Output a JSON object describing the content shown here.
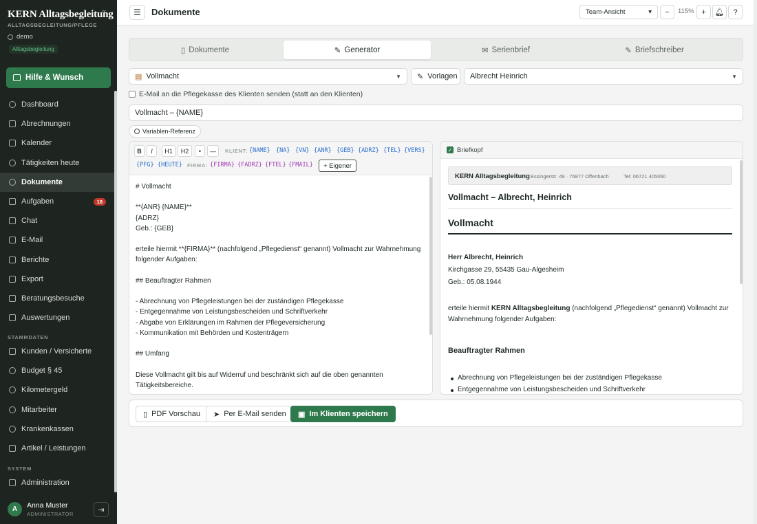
{
  "sidebar": {
    "brand": "KERN Alltagsbegleitung",
    "subtitle": "ALLTAGSBEGLEITUNG/PFLEGE",
    "tenant": "demo",
    "tag": "Alltagsbegleitung",
    "help_label": "Hilfe & Wunsch",
    "nav": [
      {
        "label": "Dashboard"
      },
      {
        "label": "Abrechnungen"
      },
      {
        "label": "Kalender"
      },
      {
        "label": "Tätigkeiten heute"
      },
      {
        "label": "Dokumente",
        "active": true
      },
      {
        "label": "Aufgaben",
        "count": "18"
      },
      {
        "label": "Chat"
      },
      {
        "label": "E-Mail"
      },
      {
        "label": "Berichte"
      },
      {
        "label": "Export"
      },
      {
        "label": "Beratungsbesuche"
      },
      {
        "label": "Auswertungen"
      }
    ],
    "section_stammdaten": "STAMMDATEN",
    "stammdaten": [
      {
        "label": "Kunden / Versicherte"
      },
      {
        "label": "Budget § 45"
      },
      {
        "label": "Kilometergeld"
      },
      {
        "label": "Mitarbeiter"
      },
      {
        "label": "Krankenkassen"
      },
      {
        "label": "Artikel / Leistungen"
      }
    ],
    "section_system": "SYSTEM",
    "system": [
      {
        "label": "Administration"
      }
    ],
    "user": {
      "initial": "A",
      "name": "Anna Muster",
      "role": "ADMINISTRATOR"
    }
  },
  "topbar": {
    "title": "Dokumente",
    "view_select": "Team-Ansicht",
    "zoom": "115%",
    "zoom_out": "−",
    "zoom_in": "+"
  },
  "tabs": [
    {
      "label": "Dokumente"
    },
    {
      "label": "Generator",
      "active": true
    },
    {
      "label": "Serienbrief"
    },
    {
      "label": "Briefschreiber"
    }
  ],
  "form": {
    "template_select": "Vollmacht",
    "templates_button": "Vorlagen",
    "client_select": "Albrecht Heinrich",
    "checkbox_label": "E-Mail an die Pflegekasse des Klienten senden (statt an den Klienten)",
    "subject": "Vollmacht – {NAME}",
    "var_ref_label": "Variablen-Referenz"
  },
  "toolbar": {
    "bold": "B",
    "italic": "I",
    "h1": "H1",
    "h2": "H2",
    "bullet": "•",
    "rule": "—",
    "label_klient": "KLIENT:",
    "klient_vars": [
      "{NAME}",
      "{NA}",
      "{VN}",
      "{ANR}",
      "{GEB}",
      "{ADRZ}",
      "{TEL}",
      "{VERS}"
    ],
    "klient_vars_row2": [
      "{PFG}",
      "{HEUTE}"
    ],
    "label_firma": "FIRMA:",
    "firma_vars": [
      "{FIRMA}",
      "{FADRZ}",
      "{FTEL}",
      "{FMAIL}"
    ],
    "custom": "+ Eigener"
  },
  "editor_lines": [
    "# Vollmacht",
    "",
    "**{ANR} {NAME}**",
    "{ADRZ}",
    "Geb.: {GEB}",
    "",
    "erteile hiermit **{FIRMA}** (nachfolgend „Pflegedienst“ genannt) Vollmacht zur Wahrnehmung",
    "folgender Aufgaben:",
    "",
    "## Beauftragter Rahmen",
    "",
    "- Abrechnung von Pflegeleistungen bei der zuständigen Pflegekasse",
    "- Entgegennahme von Leistungsbescheiden und Schriftverkehr",
    "- Abgabe von Erklärungen im Rahmen der Pflegeversicherung",
    "- Kommunikation mit Behörden und Kostenträgern",
    "",
    "## Umfang",
    "",
    "Diese Vollmacht gilt bis auf Widerruf und beschränkt sich auf die oben genannten",
    "Tätigkeitsbereiche."
  ],
  "preview": {
    "briefkopf_label": "Briefkopf",
    "lh_name": "KERN Alltagsbegleitung",
    "lh_address": "Essingerstr. 49 · 76877 Offenbach",
    "lh_tel": "Tel: 06721 405060",
    "doc_title": "Vollmacht – Albrecht, Heinrich",
    "h1": "Vollmacht",
    "recipient_name": "Herr Albrecht, Heinrich",
    "recipient_address": "Kirchgasse 29, 55435 Gau-Algesheim",
    "recipient_birth": "Geb.: 05.08.1944",
    "para_prefix": "erteile hiermit ",
    "para_firm": "KERN Alltagsbegleitung",
    "para_suffix": " (nachfolgend „Pflegedienst“ genannt) Vollmacht zur Wahrnehmung folgender Aufgaben:",
    "h2": "Beauftragter Rahmen",
    "list": [
      "Abrechnung von Pflegeleistungen bei der zuständigen Pflegekasse",
      "Entgegennahme von Leistungsbescheiden und Schriftverkehr"
    ]
  },
  "actions": {
    "pdf": "PDF Vorschau",
    "email": "Per E-Mail senden",
    "save": "Im Klienten speichern"
  }
}
